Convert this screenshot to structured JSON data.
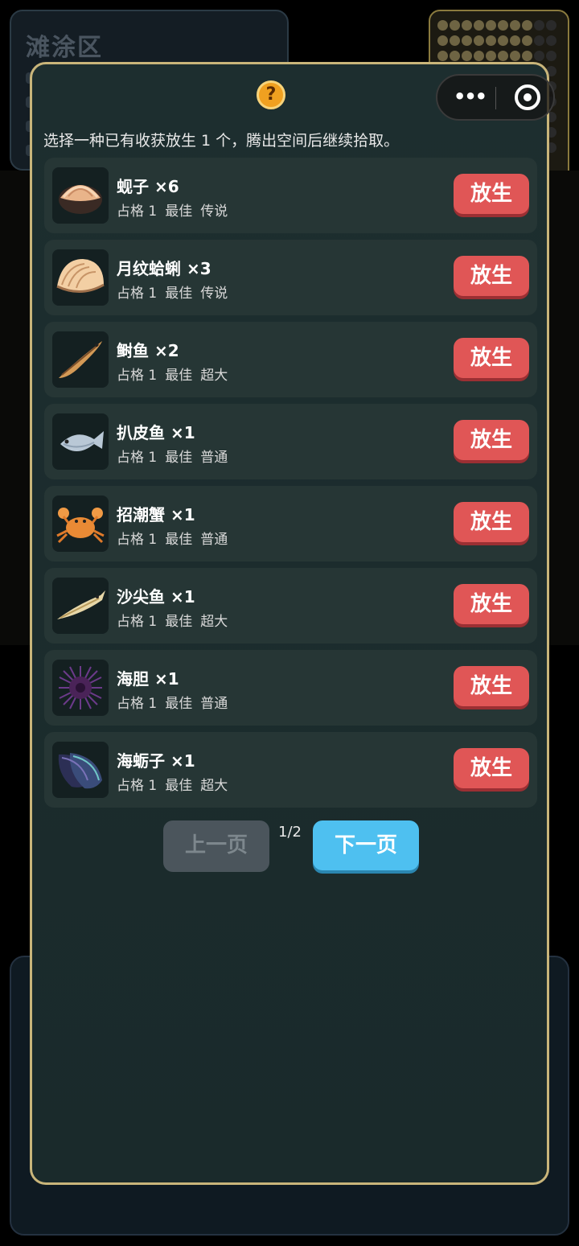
{
  "background": {
    "area_title": "滩涂区"
  },
  "dialog": {
    "hint": "选择一种已有收获放生 1 个，腾出空间后继续拾取。",
    "release_label": "放生",
    "items": [
      {
        "name": "蚬子 ×6",
        "slot": "占格 1",
        "best": "最佳",
        "rarity": "传说",
        "icon": "clam-icon"
      },
      {
        "name": "月纹蛤蜊 ×3",
        "slot": "占格 1",
        "best": "最佳",
        "rarity": "传说",
        "icon": "shell-icon"
      },
      {
        "name": "鲥鱼 ×2",
        "slot": "占格 1",
        "best": "最佳",
        "rarity": "超大",
        "icon": "eel-fish-icon"
      },
      {
        "name": "扒皮鱼 ×1",
        "slot": "占格 1",
        "best": "最佳",
        "rarity": "普通",
        "icon": "flatfish-icon"
      },
      {
        "name": "招潮蟹 ×1",
        "slot": "占格 1",
        "best": "最佳",
        "rarity": "普通",
        "icon": "crab-icon"
      },
      {
        "name": "沙尖鱼 ×1",
        "slot": "占格 1",
        "best": "最佳",
        "rarity": "超大",
        "icon": "sand-fish-icon"
      },
      {
        "name": "海胆 ×1",
        "slot": "占格 1",
        "best": "最佳",
        "rarity": "普通",
        "icon": "urchin-icon"
      },
      {
        "name": "海蛎子 ×1",
        "slot": "占格 1",
        "best": "最佳",
        "rarity": "超大",
        "icon": "mussel-icon"
      }
    ],
    "pager": {
      "prev_label": "上一页",
      "page_indicator": "1/2",
      "next_label": "下一页"
    }
  },
  "colors": {
    "release_button": "#e05656",
    "next_button": "#4ec0f0",
    "disabled_button": "#4b555c",
    "modal_border": "#c9b57a"
  }
}
